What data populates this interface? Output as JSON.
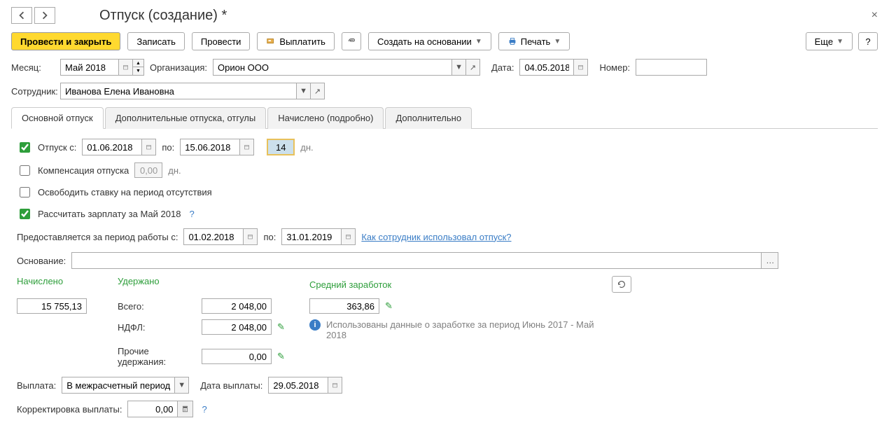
{
  "title": "Отпуск (создание) *",
  "toolbar": {
    "postAndClose": "Провести и закрыть",
    "save": "Записать",
    "post": "Провести",
    "pay": "Выплатить",
    "createBased": "Создать на основании",
    "print": "Печать",
    "more": "Еще"
  },
  "header": {
    "monthLabel": "Месяц:",
    "month": "Май 2018",
    "orgLabel": "Организация:",
    "org": "Орион ООО",
    "dateLabel": "Дата:",
    "date": "04.05.2018",
    "numberLabel": "Номер:",
    "number": "",
    "employeeLabel": "Сотрудник:",
    "employee": "Иванова Елена Ивановна"
  },
  "tabs": [
    "Основной отпуск",
    "Дополнительные отпуска, отгулы",
    "Начислено (подробно)",
    "Дополнительно"
  ],
  "main": {
    "vacationLabel": "Отпуск  с:",
    "from": "01.06.2018",
    "toLabel": "по:",
    "to": "15.06.2018",
    "days": "14",
    "daysUnit": "дн.",
    "compLabel": "Компенсация отпуска",
    "compDays": "0,00",
    "compUnit": "дн.",
    "releaseLabel": "Освободить ставку на период отсутствия",
    "calcLabel": "Рассчитать зарплату за Май 2018",
    "periodLabel": "Предоставляется за период работы с:",
    "periodFrom": "01.02.2018",
    "periodToLabel": "по:",
    "periodTo": "31.01.2019",
    "usageLink": "Как сотрудник использовал отпуск?",
    "basisLabel": "Основание:",
    "basis": ""
  },
  "calc": {
    "accruedLabel": "Начислено",
    "accrued": "15 755,13",
    "withheldLabel": "Удержано",
    "totalLabel": "Всего:",
    "total": "2 048,00",
    "ndflLabel": "НДФЛ:",
    "ndfl": "2 048,00",
    "otherLabel": "Прочие удержания:",
    "other": "0,00",
    "avgLabel": "Средний заработок",
    "avg": "363,86",
    "info": "Использованы данные о заработке за период Июнь 2017 - Май 2018"
  },
  "payment": {
    "payoutLabel": "Выплата:",
    "payout": "В межрасчетный период",
    "payDateLabel": "Дата выплаты:",
    "payDate": "29.05.2018",
    "corrLabel": "Корректировка выплаты:",
    "corr": "0,00"
  }
}
